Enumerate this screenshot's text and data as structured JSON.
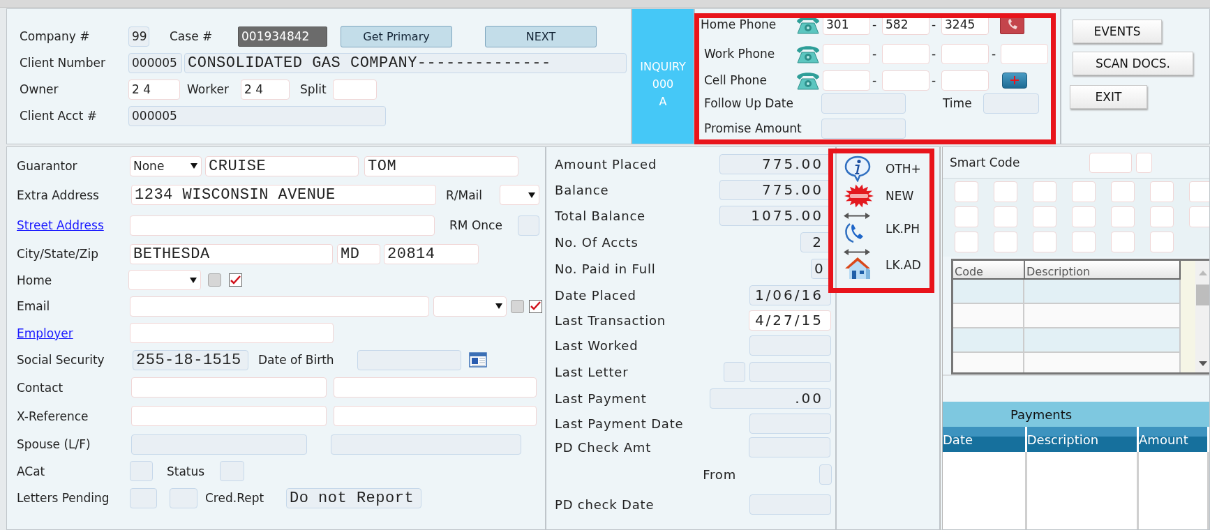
{
  "case_panel": {
    "rows": [
      {
        "items": [
          {
            "kind": "label",
            "text": "Company #"
          },
          {
            "kind": "display",
            "value": "99"
          },
          {
            "kind": "label",
            "text": "Case #"
          },
          {
            "kind": "highlighted",
            "value": "001934842"
          },
          {
            "kind": "button",
            "text": "Get Primary"
          },
          {
            "kind": "button",
            "text": "NEXT"
          }
        ]
      },
      {
        "items": [
          {
            "kind": "label",
            "text": "Client Number"
          },
          {
            "kind": "display",
            "value": "000005"
          },
          {
            "kind": "display",
            "value": "CONSOLIDATED GAS COMPANY--------------"
          }
        ]
      },
      {
        "items": [
          {
            "kind": "label",
            "text": "Owner"
          },
          {
            "kind": "input",
            "value": "2 4"
          },
          {
            "kind": "label",
            "text": "Worker"
          },
          {
            "kind": "input",
            "value": "2 4"
          },
          {
            "kind": "label",
            "text": "Split"
          },
          {
            "kind": "input"
          }
        ]
      },
      {
        "items": [
          {
            "kind": "label",
            "text": "Client Acct #"
          },
          {
            "kind": "display",
            "value": "000005"
          }
        ]
      }
    ]
  },
  "inquiry": {
    "lines": [
      "INQUIRY",
      "000",
      "A"
    ]
  },
  "phone_panel": {
    "rows": [
      {
        "items": [
          {
            "kind": "label",
            "text": "Home Phone"
          },
          {
            "kind": "input",
            "value": "301"
          },
          {
            "kind": "label",
            "text": "-"
          },
          {
            "kind": "input",
            "value": "582"
          },
          {
            "kind": "label",
            "text": "-"
          },
          {
            "kind": "input",
            "value": "3245"
          }
        ]
      },
      {
        "items": [
          {
            "kind": "label",
            "text": "Work Phone"
          },
          {
            "kind": "input"
          },
          {
            "kind": "label",
            "text": "-"
          },
          {
            "kind": "input"
          },
          {
            "kind": "label",
            "text": "-"
          },
          {
            "kind": "input"
          },
          {
            "kind": "label",
            "text": "-"
          },
          {
            "kind": "input"
          }
        ]
      },
      {
        "items": [
          {
            "kind": "label",
            "text": "Cell Phone"
          },
          {
            "kind": "input"
          },
          {
            "kind": "label",
            "text": "-"
          },
          {
            "kind": "input"
          },
          {
            "kind": "label",
            "text": "-"
          },
          {
            "kind": "input"
          }
        ]
      },
      {
        "items": [
          {
            "kind": "label",
            "text": "Follow Up Date"
          },
          {
            "kind": "display"
          },
          {
            "kind": "label",
            "text": "Time"
          },
          {
            "kind": "display"
          }
        ]
      },
      {
        "items": [
          {
            "kind": "label",
            "text": "Promise Amount"
          },
          {
            "kind": "display"
          }
        ]
      }
    ]
  },
  "actions": [
    "EVENTS",
    "SCAN DOCS.",
    "EXIT"
  ],
  "account_panel": {
    "rows": [
      {
        "items": [
          {
            "kind": "label",
            "text": "Guarantor"
          },
          {
            "kind": "select",
            "value": "None"
          },
          {
            "kind": "input",
            "value": "CRUISE"
          },
          {
            "kind": "input",
            "value": "TOM"
          }
        ]
      },
      {
        "items": [
          {
            "kind": "label",
            "text": "Extra Address"
          },
          {
            "kind": "input",
            "value": "1234 WISCONSIN AVENUE"
          },
          {
            "kind": "label",
            "text": "R/Mail"
          },
          {
            "kind": "select"
          }
        ]
      },
      {
        "items": [
          {
            "kind": "link",
            "text": "Street Address"
          },
          {
            "kind": "input"
          },
          {
            "kind": "label",
            "text": "RM Once"
          },
          {
            "kind": "display"
          }
        ]
      },
      {
        "items": [
          {
            "kind": "label",
            "text": "City/State/Zip"
          },
          {
            "kind": "input",
            "value": "BETHESDA"
          },
          {
            "kind": "input",
            "value": "MD"
          },
          {
            "kind": "input",
            "value": "20814"
          }
        ]
      },
      {
        "items": [
          {
            "kind": "label",
            "text": "Home"
          },
          {
            "kind": "select"
          },
          {
            "kind": "checkbox",
            "checked": false
          },
          {
            "kind": "checkbox",
            "checked": true
          }
        ]
      },
      {
        "items": [
          {
            "kind": "label",
            "text": "Email"
          },
          {
            "kind": "input"
          },
          {
            "kind": "select"
          },
          {
            "kind": "checkbox",
            "checked": false
          },
          {
            "kind": "checkbox",
            "checked": true
          }
        ]
      },
      {
        "items": [
          {
            "kind": "link",
            "text": "Employer"
          },
          {
            "kind": "input"
          }
        ]
      },
      {
        "items": [
          {
            "kind": "label",
            "text": "Social Security"
          },
          {
            "kind": "display",
            "value": "255-18-1515"
          },
          {
            "kind": "label",
            "text": "Date of Birth"
          },
          {
            "kind": "display"
          }
        ]
      },
      {
        "items": [
          {
            "kind": "label",
            "text": "Contact"
          },
          {
            "kind": "input"
          },
          {
            "kind": "input"
          }
        ]
      },
      {
        "items": [
          {
            "kind": "label",
            "text": "X-Reference"
          },
          {
            "kind": "input"
          },
          {
            "kind": "input"
          }
        ]
      },
      {
        "items": [
          {
            "kind": "label",
            "text": "Spouse (L/F)"
          },
          {
            "kind": "display"
          },
          {
            "kind": "display"
          }
        ]
      },
      {
        "items": [
          {
            "kind": "label",
            "text": "ACat"
          },
          {
            "kind": "display"
          },
          {
            "kind": "label",
            "text": "Status"
          },
          {
            "kind": "display"
          }
        ]
      },
      {
        "items": [
          {
            "kind": "label",
            "text": "Letters Pending"
          },
          {
            "kind": "display"
          },
          {
            "kind": "display"
          },
          {
            "kind": "label",
            "text": "Cred.Rept"
          },
          {
            "kind": "display",
            "value": "Do not Report"
          }
        ]
      }
    ]
  },
  "balance_panel": {
    "rows": [
      {
        "items": [
          {
            "kind": "label",
            "text": "Amount Placed"
          },
          {
            "kind": "display",
            "value": "775.00"
          }
        ]
      },
      {
        "items": [
          {
            "kind": "label",
            "text": "Balance"
          },
          {
            "kind": "display",
            "value": "775.00"
          }
        ]
      },
      {
        "items": [
          {
            "kind": "label",
            "text": "Total Balance"
          },
          {
            "kind": "display",
            "value": "1075.00"
          }
        ]
      },
      {
        "items": [
          {
            "kind": "label",
            "text": "No. Of Accts"
          },
          {
            "kind": "display",
            "value": "2"
          }
        ]
      },
      {
        "items": [
          {
            "kind": "label",
            "text": "No. Paid in Full"
          },
          {
            "kind": "display",
            "value": "0"
          }
        ]
      },
      {
        "items": [
          {
            "kind": "label",
            "text": "Date Placed"
          },
          {
            "kind": "display",
            "value": "1/06/16"
          }
        ]
      },
      {
        "items": [
          {
            "kind": "label",
            "text": "Last Transaction"
          },
          {
            "kind": "input",
            "value": "4/27/15"
          }
        ]
      },
      {
        "items": [
          {
            "kind": "label",
            "text": "Last Worked"
          },
          {
            "kind": "display"
          }
        ]
      },
      {
        "items": [
          {
            "kind": "label",
            "text": "Last Letter"
          },
          {
            "kind": "display"
          },
          {
            "kind": "display"
          }
        ]
      },
      {
        "items": [
          {
            "kind": "label",
            "text": "Last Payment"
          },
          {
            "kind": "display",
            "value": ".00"
          }
        ]
      },
      {
        "items": [
          {
            "kind": "label",
            "text": "Last Payment Date"
          },
          {
            "kind": "display"
          }
        ]
      },
      {
        "items": [
          {
            "kind": "label",
            "text": "PD Check Amt"
          },
          {
            "kind": "display"
          }
        ]
      },
      {
        "items": [
          {
            "kind": "label",
            "text": "From"
          },
          {
            "kind": "display"
          }
        ]
      },
      {
        "items": [
          {
            "kind": "label",
            "text": "PD check Date"
          },
          {
            "kind": "display"
          }
        ]
      }
    ]
  },
  "quick_links": [
    "OTH+",
    "NEW",
    "LK.PH",
    "LK.AD"
  ],
  "smart_code": {
    "rows": [
      {
        "items": [
          {
            "kind": "label",
            "text": "Smart Code"
          },
          {
            "kind": "input"
          },
          {
            "kind": "input"
          }
        ]
      }
    ],
    "grid": [
      {
        "items": [
          {
            "kind": "input"
          },
          {
            "kind": "input"
          },
          {
            "kind": "input"
          },
          {
            "kind": "input"
          },
          {
            "kind": "input"
          },
          {
            "kind": "input"
          },
          {
            "kind": "input"
          }
        ]
      },
      {
        "items": [
          {
            "kind": "input"
          },
          {
            "kind": "input"
          },
          {
            "kind": "input"
          },
          {
            "kind": "input"
          },
          {
            "kind": "input"
          },
          {
            "kind": "input"
          },
          {
            "kind": "input"
          }
        ]
      },
      {
        "items": [
          {
            "kind": "input"
          },
          {
            "kind": "input"
          },
          {
            "kind": "input"
          },
          {
            "kind": "input"
          },
          {
            "kind": "input"
          },
          {
            "kind": "input"
          }
        ]
      }
    ]
  },
  "code_table": {
    "columns": [
      "Code",
      "Description"
    ]
  },
  "payments": {
    "title": "Payments",
    "columns": [
      "Date",
      "Description",
      "Amount"
    ]
  }
}
